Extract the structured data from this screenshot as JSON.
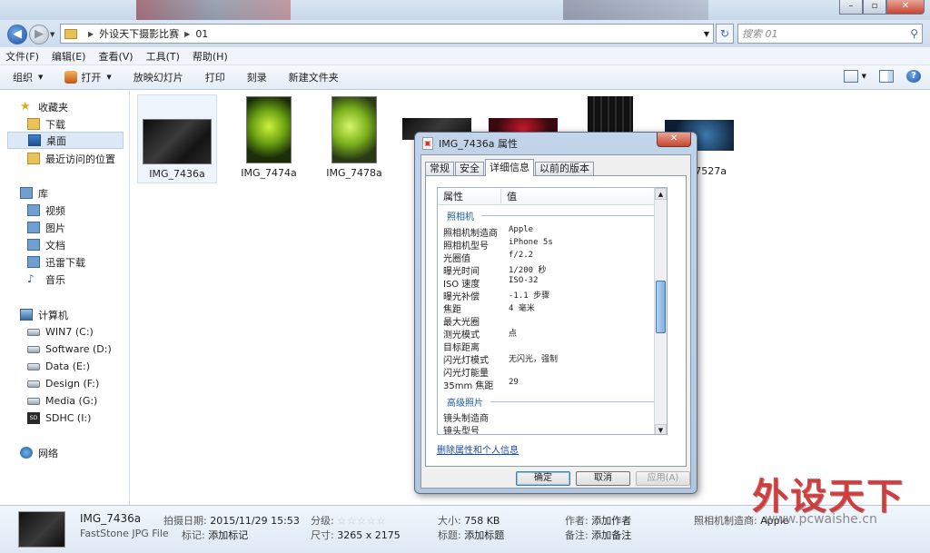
{
  "address": {
    "crumbs": [
      "外设天下摄影比赛",
      "01"
    ],
    "search_placeholder": "搜索 01"
  },
  "menu": [
    "文件(F)",
    "编辑(E)",
    "查看(V)",
    "工具(T)",
    "帮助(H)"
  ],
  "toolbar": {
    "organize": "组织",
    "open": "打开",
    "slideshow": "放映幻灯片",
    "print": "打印",
    "burn": "刻录",
    "new_folder": "新建文件夹"
  },
  "sidebar": {
    "favorites": "收藏夹",
    "downloads": "下载",
    "desktop": "桌面",
    "recent": "最近访问的位置",
    "libraries": "库",
    "videos": "视频",
    "pictures": "图片",
    "documents": "文档",
    "thunder": "迅雷下载",
    "music": "音乐",
    "computer": "计算机",
    "drive_c": "WIN7 (C:)",
    "drive_d": "Software (D:)",
    "drive_e": "Data (E:)",
    "drive_f": "Design (F:)",
    "drive_g": "Media (G:)",
    "drive_i": "SDHC (I:)",
    "network": "网络"
  },
  "files": {
    "f1": "IMG_7436a",
    "f2": "IMG_7474a",
    "f3": "IMG_7478a",
    "f4": "7527a"
  },
  "dialog": {
    "title": "IMG_7436a 属性",
    "close": "✕",
    "tabs": [
      "常规",
      "安全",
      "详细信息",
      "以前的版本"
    ],
    "col_property": "属性",
    "col_value": "值",
    "group_camera": "照相机",
    "group_advanced": "高级照片",
    "rows": [
      {
        "k": "照相机制造商",
        "v": "Apple"
      },
      {
        "k": "照相机型号",
        "v": "iPhone 5s"
      },
      {
        "k": "光圈值",
        "v": "f/2.2"
      },
      {
        "k": "曝光时间",
        "v": "1/200 秒"
      },
      {
        "k": "ISO 速度",
        "v": "ISO-32"
      },
      {
        "k": "曝光补偿",
        "v": "-1.1 步骤"
      },
      {
        "k": "焦距",
        "v": "4 毫米"
      },
      {
        "k": "最大光圈",
        "v": ""
      },
      {
        "k": "测光模式",
        "v": "点"
      },
      {
        "k": "目标距离",
        "v": ""
      },
      {
        "k": "闪光灯模式",
        "v": "无闪光，强制"
      },
      {
        "k": "闪光灯能量",
        "v": ""
      },
      {
        "k": "35mm 焦距",
        "v": "29"
      }
    ],
    "adv_rows": [
      {
        "k": "镜头制造商",
        "v": ""
      },
      {
        "k": "镜头型号",
        "v": ""
      }
    ],
    "remove_link": "删除属性和个人信息",
    "ok": "确定",
    "cancel": "取消",
    "apply": "应用(A)"
  },
  "status": {
    "name": "IMG_7436a",
    "type": "FastStone JPG File",
    "date_label": "拍摄日期:",
    "date_value": "2015/11/29 15:53",
    "tags_label": "标记:",
    "tags_value": "添加标记",
    "rating_label": "分级:",
    "dims_label": "尺寸:",
    "dims_value": "3265 x 2175",
    "size_label": "大小:",
    "size_value": "758 KB",
    "title_label": "标题:",
    "title_value": "添加标题",
    "author_label": "作者:",
    "author_value": "添加作者",
    "comment_label": "备注:",
    "comment_value": "添加备注",
    "maker_label": "照相机制造商:",
    "maker_value": "Apple"
  },
  "watermark": {
    "brand": "外设天下",
    "url": "www.pcwaishe.cn"
  }
}
